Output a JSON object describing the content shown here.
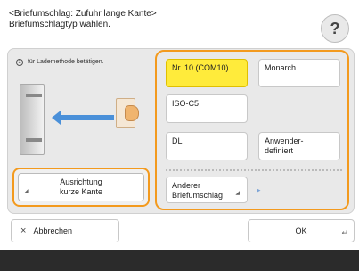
{
  "header": {
    "line1": "<Briefumschlag: Zufuhr lange Kante>",
    "line2": "Briefumschlagtyp wählen."
  },
  "help": {
    "label": "?"
  },
  "illustration": {
    "step_number": "1",
    "caption": "für Lademethode betätigen."
  },
  "orientation_button": {
    "label_line1": "Ausrichtung",
    "label_line2": "kurze Kante"
  },
  "envelope_types": [
    {
      "label": "Nr. 10 (COM10)",
      "selected": true
    },
    {
      "label": "Monarch",
      "selected": false
    },
    {
      "label": "ISO-C5",
      "selected": false
    },
    {
      "label": "DL",
      "selected": false
    },
    {
      "label": "Anwender- definiert",
      "selected": false
    }
  ],
  "other_envelope": {
    "label": "Anderer Briefumschlag"
  },
  "actions": {
    "cancel": "Abbrechen",
    "ok": "OK"
  },
  "colors": {
    "accent": "#f39a1e",
    "selected": "#ffeb3b",
    "panel": "#e9e9e9",
    "footer": "#2b2b2b"
  }
}
